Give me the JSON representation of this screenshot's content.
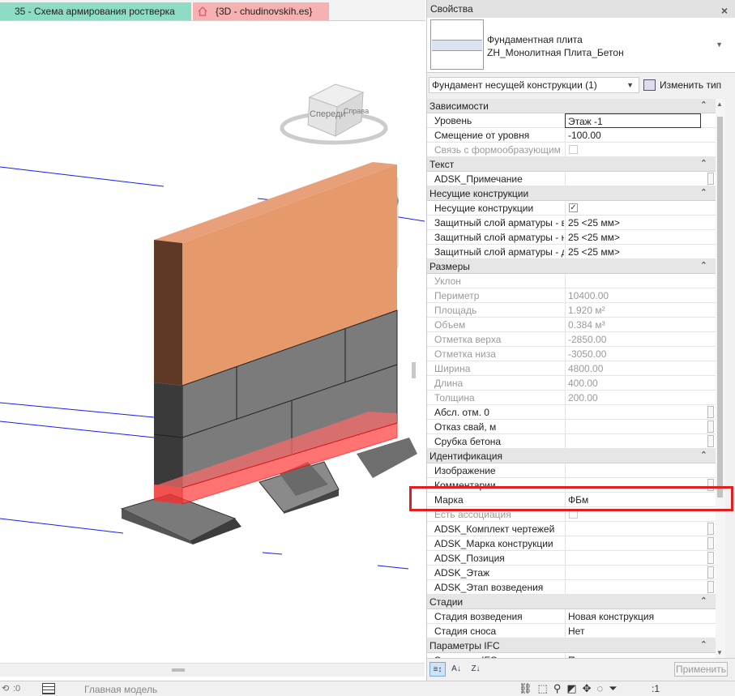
{
  "tabs": [
    {
      "label": "35 - Схема армирования ростверка"
    },
    {
      "label": "{3D - chudinovskih.es}",
      "icon": "home-icon"
    }
  ],
  "viewcube": {
    "front": "Спереди",
    "right": "Справа"
  },
  "properties": {
    "title": "Свойства",
    "type_family": "Фундаментная плита",
    "type_name": "ZH_Монолитная Плита_Бетон",
    "filter": "Фундамент несущей конструкции (1)",
    "edit_type": "Изменить тип",
    "apply": "Применить",
    "groups": [
      {
        "label": "Зависимости",
        "rows": [
          {
            "name": "Уровень",
            "value": "Этаж -1",
            "boxed": true
          },
          {
            "name": "Смещение от уровня",
            "value": "-100.00"
          },
          {
            "name": "Связь с формообразующим",
            "checkbox": false,
            "readonly": true
          }
        ]
      },
      {
        "label": "Текст",
        "rows": [
          {
            "name": "ADSK_Примечание",
            "value": "",
            "button": true
          }
        ]
      },
      {
        "label": "Несущие конструкции",
        "rows": [
          {
            "name": "Несущие конструкции",
            "checkbox": true
          },
          {
            "name": "Защитный слой арматуры - верхняя грань",
            "value": "25 <25 мм>"
          },
          {
            "name": "Защитный слой арматуры - нижняя грань",
            "value": "25 <25 мм>"
          },
          {
            "name": "Защитный слой арматуры - другие грани",
            "value": "25 <25 мм>"
          }
        ]
      },
      {
        "label": "Размеры",
        "rows": [
          {
            "name": "Уклон",
            "value": "",
            "readonly": true
          },
          {
            "name": "Периметр",
            "value": "10400.00",
            "readonly": true
          },
          {
            "name": "Площадь",
            "value": "1.920 м²",
            "readonly": true
          },
          {
            "name": "Объем",
            "value": "0.384 м³",
            "readonly": true
          },
          {
            "name": "Отметка верха",
            "value": "-2850.00",
            "readonly": true
          },
          {
            "name": "Отметка низа",
            "value": "-3050.00",
            "readonly": true
          },
          {
            "name": "Ширина",
            "value": "4800.00",
            "readonly": true
          },
          {
            "name": "Длина",
            "value": "400.00",
            "readonly": true
          },
          {
            "name": "Толщина",
            "value": "200.00",
            "readonly": true
          },
          {
            "name": "Абсл. отм. 0",
            "value": "",
            "button": true
          },
          {
            "name": "Отказ свай, м",
            "value": "",
            "button": true
          },
          {
            "name": "Срубка бетона",
            "value": "",
            "button": true
          }
        ]
      },
      {
        "label": "Идентификация",
        "rows": [
          {
            "name": "Изображение",
            "value": ""
          },
          {
            "name": "Комментарии",
            "value": "",
            "button": true
          },
          {
            "name": "Марка",
            "value": "ФБм"
          },
          {
            "name": "Есть ассоциация",
            "checkbox": false,
            "readonly": true
          },
          {
            "name": "ADSK_Комплект чертежей",
            "value": "",
            "button": true
          },
          {
            "name": "ADSK_Марка конструкции",
            "value": "",
            "button": true
          },
          {
            "name": "ADSK_Позиция",
            "value": "",
            "button": true
          },
          {
            "name": "ADSK_Этаж",
            "value": "",
            "button": true
          },
          {
            "name": "ADSK_Этап возведения",
            "value": "",
            "button": true
          }
        ]
      },
      {
        "label": "Стадии",
        "rows": [
          {
            "name": "Стадия возведения",
            "value": "Новая конструкция"
          },
          {
            "name": "Стадия сноса",
            "value": "Нет"
          }
        ]
      },
      {
        "label": "Параметры IFC",
        "rows": [
          {
            "name": "Экспорт в IFC",
            "value": "По типу"
          }
        ]
      }
    ]
  },
  "status": {
    "zero": ":0",
    "model": "Главная модель",
    "filter_count": ":1"
  },
  "colors": {
    "tab_active": "#8fdcc6",
    "tab_3d": "#f6b1b1",
    "wall": "#e69a6b",
    "block": "#7b7b7b",
    "rebar": "#ff3b3b",
    "highlight": "#e02020"
  }
}
